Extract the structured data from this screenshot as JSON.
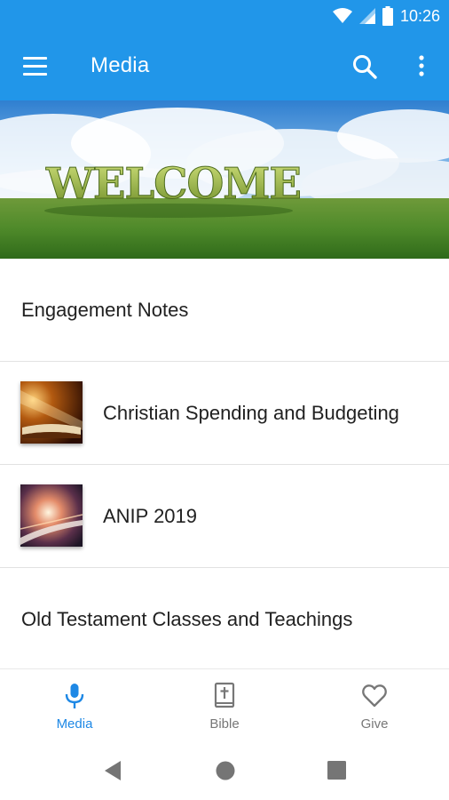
{
  "status_bar": {
    "time": "10:26"
  },
  "app_bar": {
    "title": "Media"
  },
  "banner": {
    "text": "WELCOME"
  },
  "list": {
    "items": [
      {
        "label": "Engagement Notes"
      },
      {
        "label": "Christian Spending and Budgeting"
      },
      {
        "label": "ANIP 2019"
      },
      {
        "label": "Old Testament Classes and Teachings"
      }
    ]
  },
  "bottom_nav": {
    "tabs": [
      {
        "label": "Media",
        "icon": "microphone-icon",
        "active": true
      },
      {
        "label": "Bible",
        "icon": "bible-icon",
        "active": false
      },
      {
        "label": "Give",
        "icon": "heart-icon",
        "active": false
      }
    ]
  },
  "colors": {
    "primary": "#2196e9",
    "active_tab": "#1e88e5",
    "inactive_tab": "#777777"
  }
}
